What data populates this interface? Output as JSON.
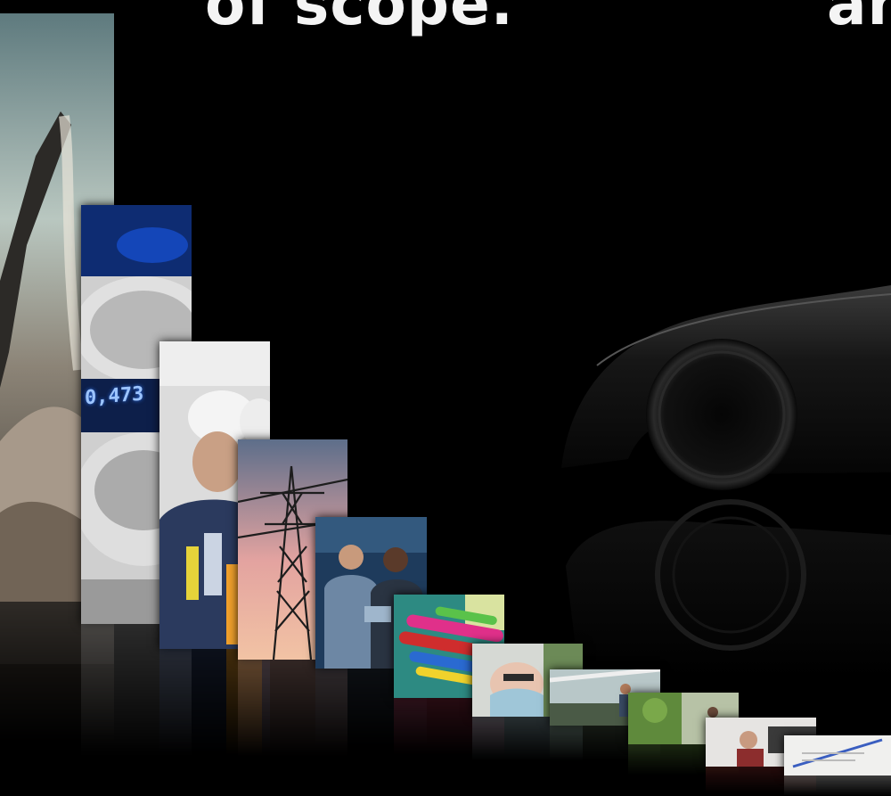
{
  "headline": {
    "left": "of scope.",
    "right": "an"
  },
  "can_readout": "0,473",
  "colors": {
    "background": "#000000",
    "headline": "#f4f4f4",
    "can_accent": "#1446b8"
  }
}
